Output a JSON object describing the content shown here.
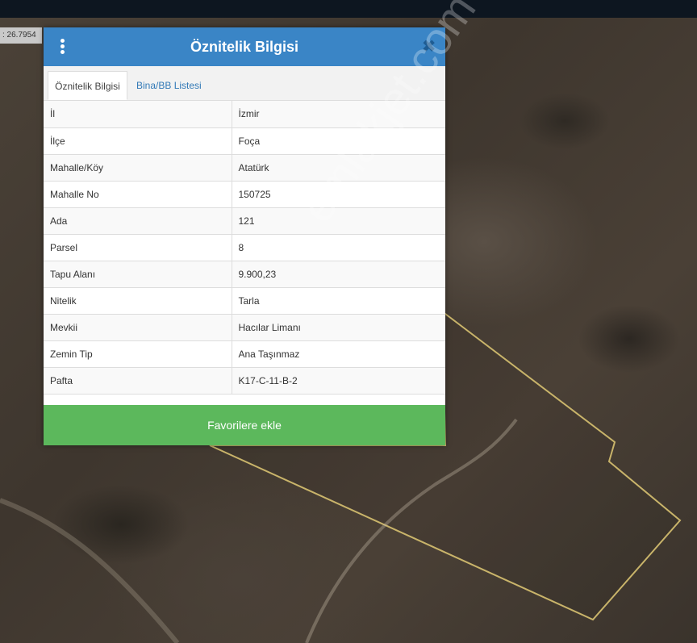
{
  "map": {
    "coordinate_text": ": 26.7954",
    "parcel_color": "#c9b46a",
    "watermark": "emlakjet.com"
  },
  "dialog": {
    "title": "Öznitelik Bilgisi",
    "close_symbol": "✖",
    "tabs": [
      {
        "label": "Öznitelik Bilgisi",
        "active": true
      },
      {
        "label": "Bina/BB Listesi",
        "active": false
      }
    ],
    "rows": [
      {
        "key": "İl",
        "value": "İzmir"
      },
      {
        "key": "İlçe",
        "value": "Foça"
      },
      {
        "key": "Mahalle/Köy",
        "value": "Atatürk"
      },
      {
        "key": "Mahalle No",
        "value": "150725"
      },
      {
        "key": "Ada",
        "value": "121"
      },
      {
        "key": "Parsel",
        "value": "8"
      },
      {
        "key": "Tapu Alanı",
        "value": "9.900,23"
      },
      {
        "key": "Nitelik",
        "value": "Tarla"
      },
      {
        "key": "Mevkii",
        "value": "Hacılar Limanı"
      },
      {
        "key": "Zemin Tip",
        "value": "Ana Taşınmaz"
      },
      {
        "key": "Pafta",
        "value": "K17-C-11-B-2"
      }
    ],
    "favorite_button": "Favorilere ekle",
    "colors": {
      "header": "#3a85c6",
      "button": "#5cb85c"
    }
  }
}
